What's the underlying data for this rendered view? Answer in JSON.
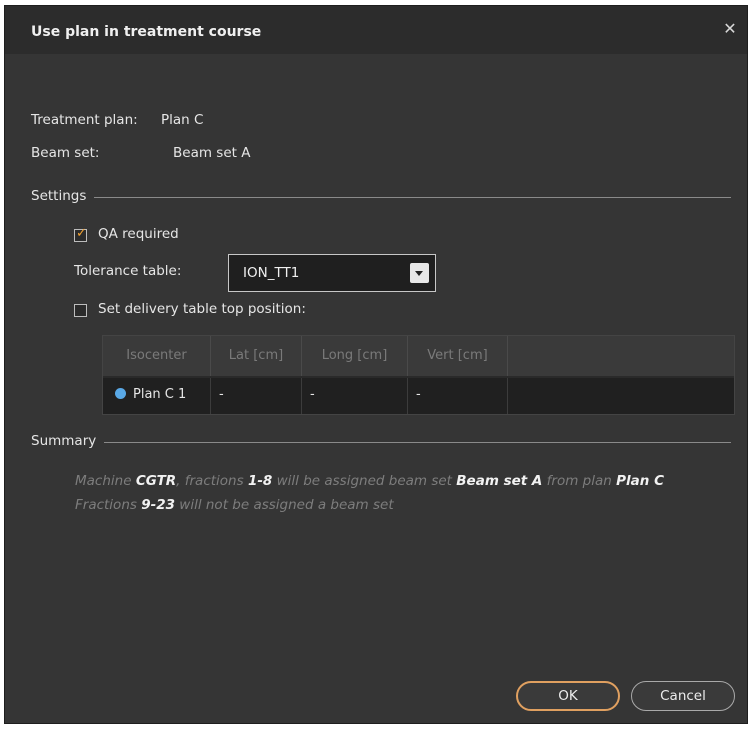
{
  "dialog": {
    "title": "Use plan in treatment course",
    "close_symbol": "✕"
  },
  "info": {
    "treatment_plan_label": "Treatment plan:",
    "treatment_plan_value": "Plan C",
    "beam_set_label": "Beam set:",
    "beam_set_value": "Beam set A"
  },
  "settings": {
    "section_label": "Settings",
    "qa_required_label": "QA required",
    "qa_required_checked": true,
    "tolerance_table_label": "Tolerance table:",
    "tolerance_table_value": "ION_TT1",
    "set_delivery_label": "Set delivery table top position:",
    "set_delivery_checked": false
  },
  "table": {
    "columns": [
      "Isocenter",
      "Lat [cm]",
      "Long [cm]",
      "Vert [cm]"
    ],
    "rows": [
      {
        "isocenter": "Plan C 1",
        "lat": "-",
        "long": "-",
        "vert": "-",
        "marker_color": "#59a8e6"
      }
    ]
  },
  "summary": {
    "section_label": "Summary",
    "line1": {
      "t1": "Machine ",
      "machine": "CGTR",
      "t2": ", fractions ",
      "fractions": "1-8",
      "t3": " will be assigned beam set ",
      "beam_set": "Beam set A",
      "t4": " from plan ",
      "plan": "Plan C"
    },
    "line2": {
      "t1": "Fractions ",
      "fractions": "9-23",
      "t2": " will not be assigned a beam set"
    }
  },
  "buttons": {
    "ok_label": "OK",
    "cancel_label": "Cancel"
  },
  "colors": {
    "accent": "#e0a060",
    "checkmark": "#f0a030",
    "background": "#353535"
  }
}
